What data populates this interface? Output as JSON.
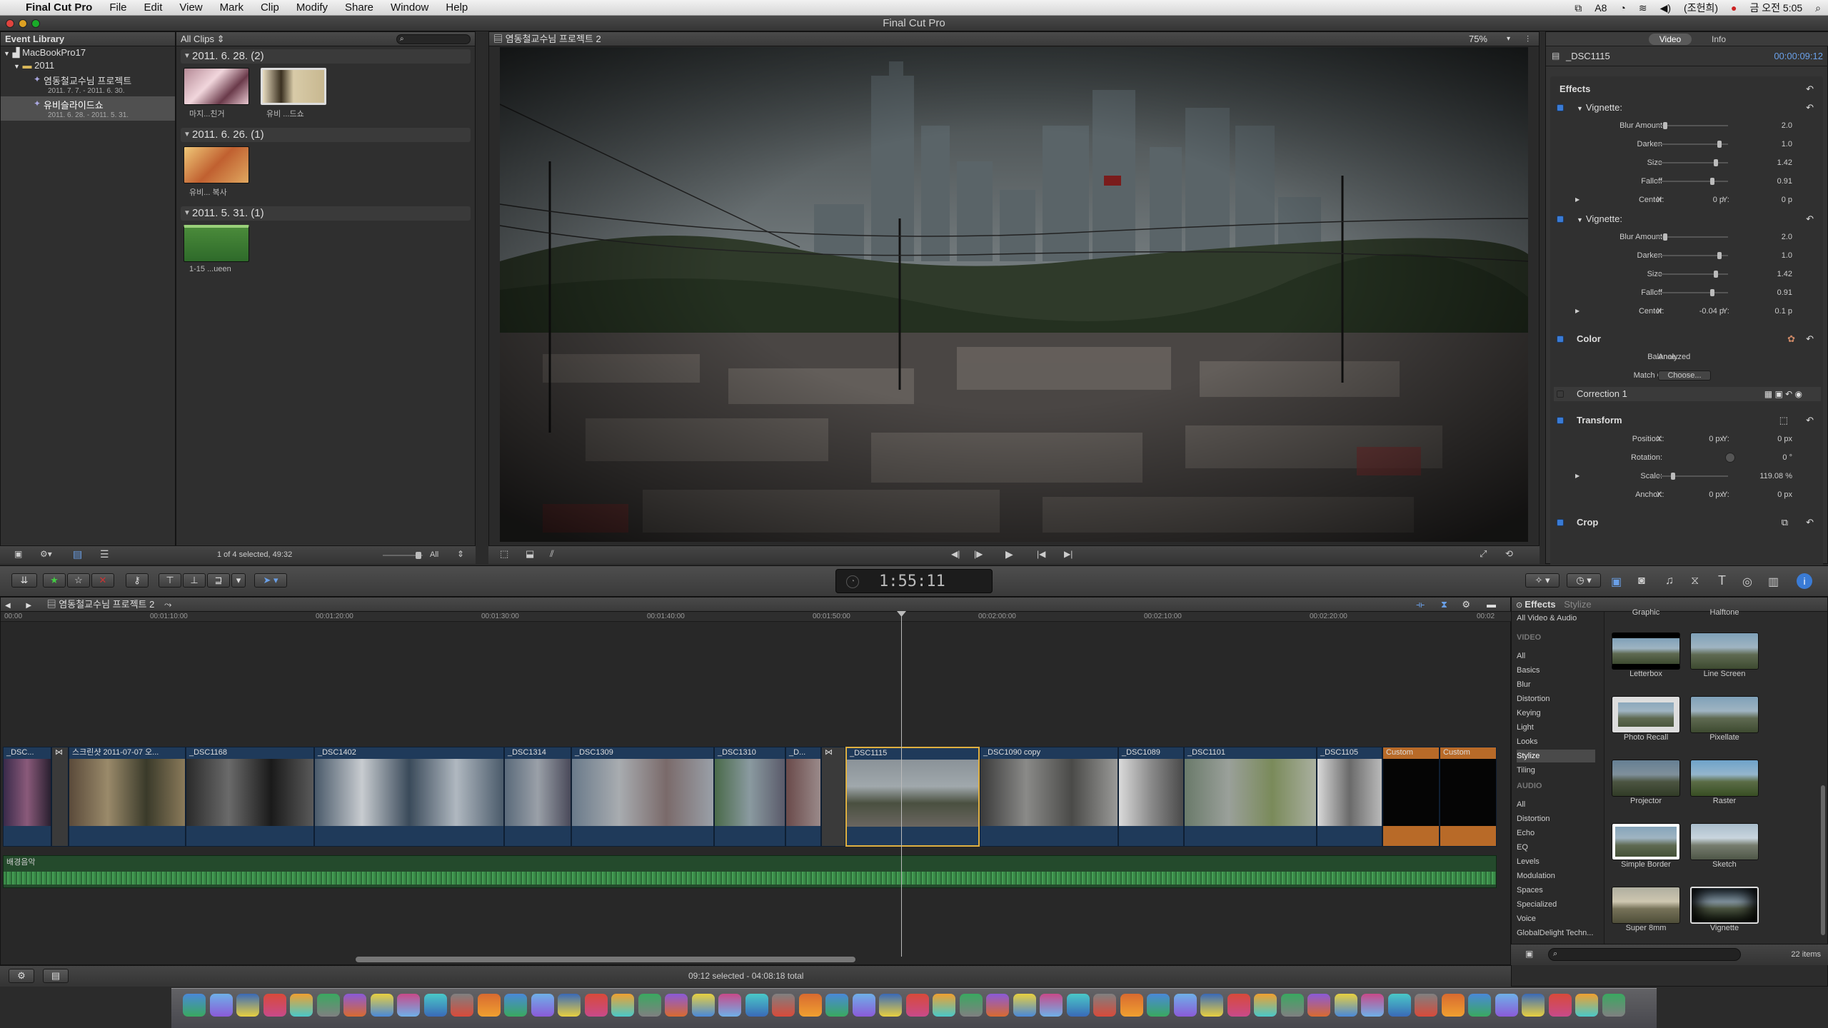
{
  "menubar": {
    "app": "Final Cut Pro",
    "items": [
      "File",
      "Edit",
      "View",
      "Mark",
      "Clip",
      "Modify",
      "Share",
      "Window",
      "Help"
    ],
    "status_items": [
      "8",
      "(조헌희)",
      "금 오전 5:05"
    ]
  },
  "window": {
    "title": "Final Cut Pro"
  },
  "event_library": {
    "header": "Event Library",
    "computer": "MacBookPro17",
    "year": "2011",
    "events": [
      {
        "name": "염동철교수님 프로젝트",
        "dates": "2011. 7. 7. - 2011. 6. 30."
      },
      {
        "name": "유비슬라이드쇼",
        "dates": "2011. 6. 28. - 2011. 5. 31."
      }
    ]
  },
  "browser": {
    "filter": "All Clips",
    "groups": [
      {
        "date": "2011. 6. 28.  (2)",
        "clips": [
          "마지...친거",
          "유비 ...드쇼"
        ]
      },
      {
        "date": "2011. 6. 26.  (1)",
        "clips": [
          "유비... 복사"
        ]
      },
      {
        "date": "2011. 5. 31.  (1)",
        "clips": [
          "1-15 ...ueen"
        ]
      }
    ],
    "status": "1 of 4 selected, 49:32",
    "show": "All"
  },
  "viewer": {
    "title": "염동철교수님 프로젝트 2",
    "zoom": "75%"
  },
  "inspector": {
    "tabs": [
      "Video",
      "Info"
    ],
    "clip_name": "_DSC1115",
    "timecode": "00:00:09:12",
    "effects_label": "Effects",
    "vignette1": {
      "name": "Vignette:",
      "params": [
        {
          "label": "Blur Amount",
          "value": "2.0",
          "level": 0.1
        },
        {
          "label": "Darken",
          "value": "1.0",
          "level": 0.9
        },
        {
          "label": "Size",
          "value": "1.42",
          "level": 0.85
        },
        {
          "label": "Falloff",
          "value": "0.91",
          "level": 0.8
        }
      ],
      "center": {
        "label": "Center",
        "x_label": "X:",
        "x": "0 p",
        "y_label": "Y:",
        "y": "0 p"
      }
    },
    "vignette2": {
      "name": "Vignette:",
      "params": [
        {
          "label": "Blur Amount",
          "value": "2.0",
          "level": 0.1
        },
        {
          "label": "Darken",
          "value": "1.0",
          "level": 0.9
        },
        {
          "label": "Size",
          "value": "1.42",
          "level": 0.85
        },
        {
          "label": "Falloff",
          "value": "0.91",
          "level": 0.8
        }
      ],
      "center": {
        "label": "Center",
        "x_label": "X:",
        "x": "-0.04 p",
        "y_label": "Y:",
        "y": "0.1 p"
      }
    },
    "color": {
      "name": "Color",
      "balance_label": "Balance:",
      "balance_value": "Analyzed",
      "match_label": "Match Color:",
      "match_button": "Choose...",
      "correction": "Correction 1"
    },
    "transform": {
      "name": "Transform",
      "position_label": "Position:",
      "pos_x": "0 px",
      "pos_y": "0 px",
      "rotation_label": "Rotation:",
      "rotation": "0 °",
      "scale_label": "Scale:",
      "scale": "119.08 %",
      "anchor_label": "Anchor:",
      "anc_x": "0 px",
      "anc_y": "0 px",
      "x_label": "X:",
      "y_label": "Y:"
    },
    "crop": {
      "name": "Crop"
    }
  },
  "dashboard": {
    "timecode": "1:55:11"
  },
  "timeline": {
    "project": "염동철교수님 프로젝트 2",
    "ruler": [
      "00:00",
      "00:01:10:00",
      "00:01:20:00",
      "00:01:30:00",
      "00:01:40:00",
      "00:01:50:00",
      "00:02:00:00",
      "00:02:10:00",
      "00:02:20:00",
      "00:02"
    ],
    "clips": [
      "_DSC...",
      "스크린샷 2011-07-07 오...",
      "_DSC1168",
      "_DSC1402",
      "_DSC1314",
      "_DSC1309",
      "_DSC1310",
      "_D...",
      "_DSC1115",
      "_DSC1090 copy",
      "_DSC1089",
      "_DSC1101",
      "_DSC1105",
      "Custom",
      "Custom"
    ],
    "audio": "배경음악",
    "status": "09:12 selected - 04:08:18 total"
  },
  "effects_browser": {
    "tabs": [
      "Effects",
      "Stylize"
    ],
    "top": "All Video & Audio",
    "video_header": "VIDEO",
    "video_cats": [
      "All",
      "Basics",
      "Blur",
      "Distortion",
      "Keying",
      "Light",
      "Looks",
      "Stylize",
      "Tiling"
    ],
    "audio_header": "AUDIO",
    "audio_cats": [
      "All",
      "Distortion",
      "Echo",
      "EQ",
      "Levels",
      "Modulation",
      "Spaces",
      "Specialized",
      "Voice",
      "GlobalDelight Techn..."
    ],
    "top_labels": [
      "Graphic",
      "Halftone"
    ],
    "items": [
      "Letterbox",
      "Line Screen",
      "Photo Recall",
      "Pixellate",
      "Projector",
      "Raster",
      "Simple Border",
      "Sketch",
      "Super 8mm",
      "Vignette"
    ],
    "count": "22 items"
  },
  "colors": {
    "accent": "#3a7bd5",
    "selection": "#e0b040",
    "audio": "#2c6a38",
    "custom_clip": "#b86a28"
  }
}
